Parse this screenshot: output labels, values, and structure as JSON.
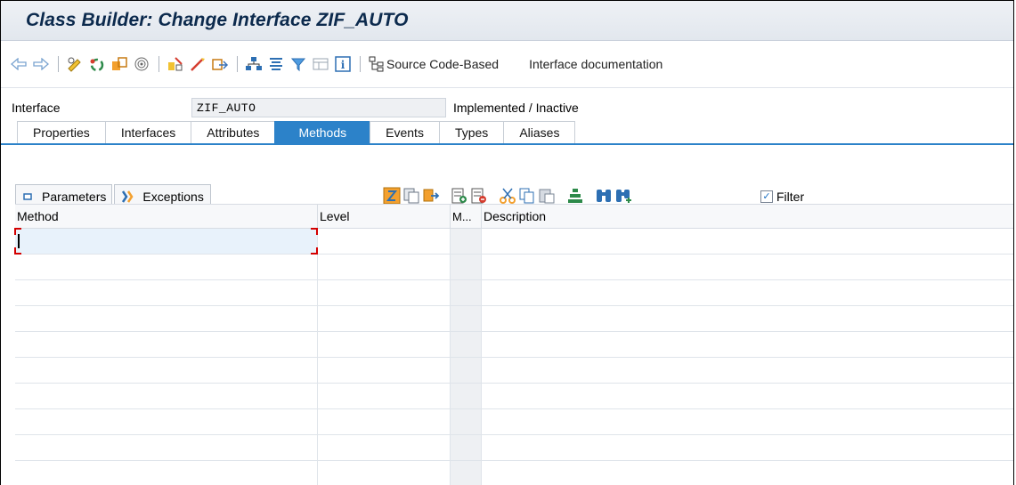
{
  "window": {
    "title": "Class Builder: Change Interface ZIF_AUTO"
  },
  "toolbar": {
    "icons": [
      "back-arrow-icon",
      "forward-arrow-icon",
      "other-object-icon",
      "display-change-icon",
      "active-inactive-icon",
      "check-icon",
      "activate-icon",
      "where-used-icon",
      "test-icon",
      "object-list-icon",
      "display-object-list-icon",
      "navigation-window-icon",
      "filter-icon",
      "layout-icon",
      "info-icon",
      "source-code-based-icon"
    ],
    "source_code_label": "Source Code-Based",
    "documentation_label": "Interface documentation"
  },
  "header": {
    "interface_label": "Interface",
    "interface_value": "ZIF_AUTO",
    "status": "Implemented / Inactive"
  },
  "tabs": [
    {
      "label": "Properties"
    },
    {
      "label": "Interfaces"
    },
    {
      "label": "Attributes"
    },
    {
      "label": "Methods",
      "active": true
    },
    {
      "label": "Events"
    },
    {
      "label": "Types"
    },
    {
      "label": "Aliases"
    }
  ],
  "subbar": {
    "parameters_label": "Parameters",
    "exceptions_label": "Exceptions",
    "filter_label": "Filter",
    "filter_checked": true
  },
  "grid": {
    "columns": [
      "Method",
      "Level",
      "M...",
      "Description"
    ],
    "row_count": 10
  },
  "colors": {
    "accent": "#2c82c9",
    "title": "#0c2a4d",
    "edit_marker": "#d40000"
  }
}
